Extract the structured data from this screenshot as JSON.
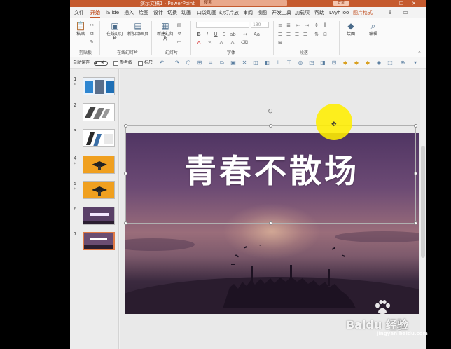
{
  "titlebar": {
    "document": "演示文稿1 - PowerPoint",
    "search_placeholder": "搜索",
    "login": "登录",
    "minimize": "—",
    "maximize": "☐",
    "close": "✕"
  },
  "tabs": [
    "文件",
    "开始",
    "iSlide",
    "插入",
    "绘图",
    "设计",
    "切换",
    "动画",
    "口袋动画",
    "幻灯片放",
    "审阅",
    "视图",
    "开发工具",
    "加载项",
    "帮助",
    "LvyhToo",
    "图片格式"
  ],
  "active_tab": "开始",
  "ribbon": {
    "paste": "粘贴",
    "clipboard": "剪贴板",
    "online_slides": "在线幻灯片",
    "new_slide_dyn": "新加动画页",
    "new_slide": "新建幻灯片",
    "group_online": "在线幻灯片",
    "group_slides": "幻灯片",
    "font_size": "130",
    "group_font": "字体",
    "group_paragraph": "段落",
    "drawing": "绘图",
    "editing": "编辑"
  },
  "qat": {
    "autosave": "自动保存",
    "autosave_state": "关",
    "guides": "参考线",
    "ruler": "标尺"
  },
  "thumbnails": [
    {
      "num": "1",
      "star": "*"
    },
    {
      "num": "2",
      "star": ""
    },
    {
      "num": "3",
      "star": ""
    },
    {
      "num": "4",
      "star": "*"
    },
    {
      "num": "5",
      "star": "*"
    },
    {
      "num": "6",
      "star": ""
    },
    {
      "num": "7",
      "star": ""
    }
  ],
  "slide": {
    "title": "青春不散场"
  },
  "watermark": {
    "text": "Baidu 经验",
    "sub": "jingyan.baidu.com"
  },
  "colors": {
    "accent": "#c55a2e",
    "cursor_highlight": "#ffee00"
  }
}
